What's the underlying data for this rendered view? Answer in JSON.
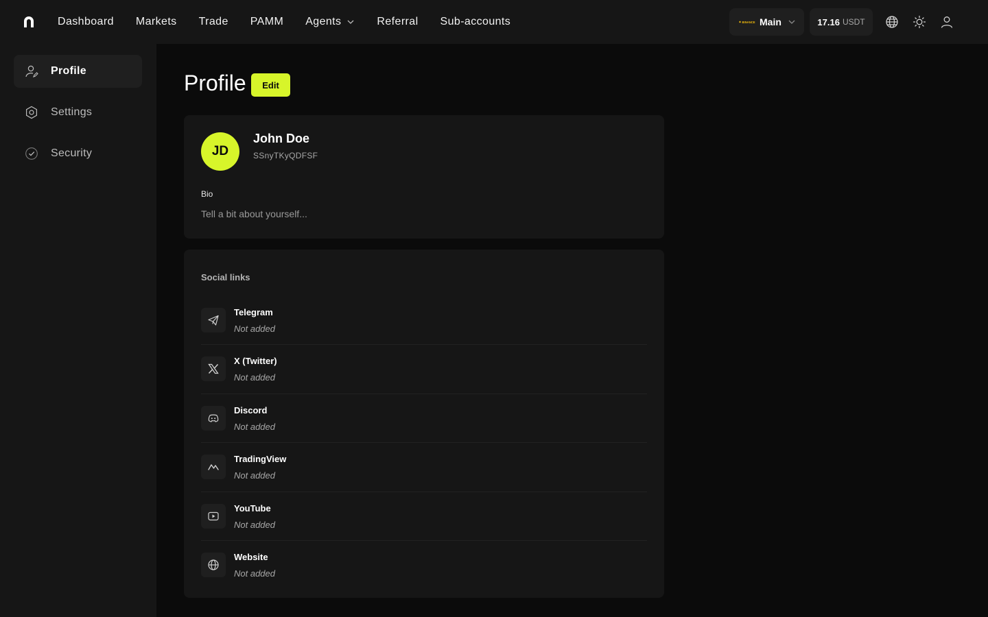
{
  "nav": {
    "items": [
      {
        "label": "Dashboard"
      },
      {
        "label": "Markets"
      },
      {
        "label": "Trade"
      },
      {
        "label": "PAMM"
      },
      {
        "label": "Agents",
        "dropdown": true
      },
      {
        "label": "Referral"
      },
      {
        "label": "Sub-accounts"
      }
    ]
  },
  "account": {
    "exchange_logo": "BINANCE",
    "label": "Main"
  },
  "balance": {
    "amount": "17.16",
    "currency": "USDT"
  },
  "top_icons": [
    "globe-icon",
    "sun-icon",
    "user-icon"
  ],
  "sidebar": {
    "items": [
      {
        "label": "Profile",
        "icon": "user-edit-icon",
        "active": true
      },
      {
        "label": "Settings",
        "icon": "settings-icon",
        "active": false
      },
      {
        "label": "Security",
        "icon": "shield-check-icon",
        "active": false
      }
    ]
  },
  "page": {
    "title": "Profile",
    "edit_label": "Edit"
  },
  "profile": {
    "initials": "JD",
    "name": "John Doe",
    "user_id": "SSnyTKyQDFSF",
    "bio_label": "Bio",
    "bio_placeholder": "Tell a bit about yourself..."
  },
  "social": {
    "title": "Social links",
    "items": [
      {
        "name": "Telegram",
        "status": "Not added",
        "icon": "telegram-icon"
      },
      {
        "name": "X (Twitter)",
        "status": "Not added",
        "icon": "x-twitter-icon"
      },
      {
        "name": "Discord",
        "status": "Not added",
        "icon": "discord-icon"
      },
      {
        "name": "TradingView",
        "status": "Not added",
        "icon": "tradingview-icon"
      },
      {
        "name": "YouTube",
        "status": "Not added",
        "icon": "youtube-icon"
      },
      {
        "name": "Website",
        "status": "Not added",
        "icon": "globe-icon"
      }
    ]
  },
  "colors": {
    "accent": "#d7f52a",
    "background": "#0b0b0b",
    "surface": "#161616",
    "surface_raised": "#1f1f1f",
    "binance_yellow": "#f0b90b"
  }
}
